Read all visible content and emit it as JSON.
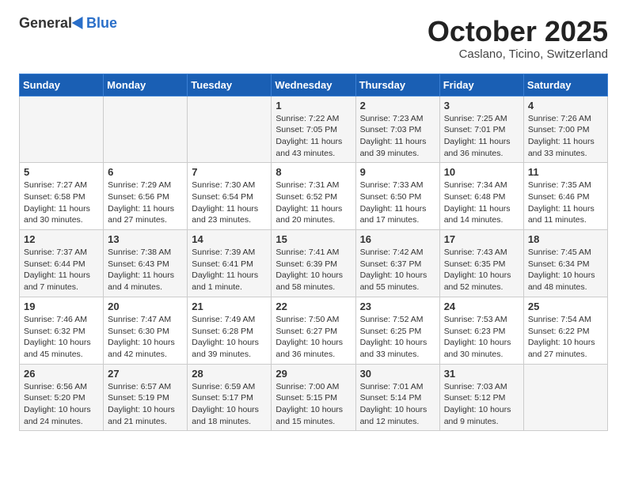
{
  "header": {
    "logo_general": "General",
    "logo_blue": "Blue",
    "month": "October 2025",
    "location": "Caslano, Ticino, Switzerland"
  },
  "days_of_week": [
    "Sunday",
    "Monday",
    "Tuesday",
    "Wednesday",
    "Thursday",
    "Friday",
    "Saturday"
  ],
  "weeks": [
    [
      {
        "day": "",
        "content": ""
      },
      {
        "day": "",
        "content": ""
      },
      {
        "day": "",
        "content": ""
      },
      {
        "day": "1",
        "content": "Sunrise: 7:22 AM\nSunset: 7:05 PM\nDaylight: 11 hours and 43 minutes."
      },
      {
        "day": "2",
        "content": "Sunrise: 7:23 AM\nSunset: 7:03 PM\nDaylight: 11 hours and 39 minutes."
      },
      {
        "day": "3",
        "content": "Sunrise: 7:25 AM\nSunset: 7:01 PM\nDaylight: 11 hours and 36 minutes."
      },
      {
        "day": "4",
        "content": "Sunrise: 7:26 AM\nSunset: 7:00 PM\nDaylight: 11 hours and 33 minutes."
      }
    ],
    [
      {
        "day": "5",
        "content": "Sunrise: 7:27 AM\nSunset: 6:58 PM\nDaylight: 11 hours and 30 minutes."
      },
      {
        "day": "6",
        "content": "Sunrise: 7:29 AM\nSunset: 6:56 PM\nDaylight: 11 hours and 27 minutes."
      },
      {
        "day": "7",
        "content": "Sunrise: 7:30 AM\nSunset: 6:54 PM\nDaylight: 11 hours and 23 minutes."
      },
      {
        "day": "8",
        "content": "Sunrise: 7:31 AM\nSunset: 6:52 PM\nDaylight: 11 hours and 20 minutes."
      },
      {
        "day": "9",
        "content": "Sunrise: 7:33 AM\nSunset: 6:50 PM\nDaylight: 11 hours and 17 minutes."
      },
      {
        "day": "10",
        "content": "Sunrise: 7:34 AM\nSunset: 6:48 PM\nDaylight: 11 hours and 14 minutes."
      },
      {
        "day": "11",
        "content": "Sunrise: 7:35 AM\nSunset: 6:46 PM\nDaylight: 11 hours and 11 minutes."
      }
    ],
    [
      {
        "day": "12",
        "content": "Sunrise: 7:37 AM\nSunset: 6:44 PM\nDaylight: 11 hours and 7 minutes."
      },
      {
        "day": "13",
        "content": "Sunrise: 7:38 AM\nSunset: 6:43 PM\nDaylight: 11 hours and 4 minutes."
      },
      {
        "day": "14",
        "content": "Sunrise: 7:39 AM\nSunset: 6:41 PM\nDaylight: 11 hours and 1 minute."
      },
      {
        "day": "15",
        "content": "Sunrise: 7:41 AM\nSunset: 6:39 PM\nDaylight: 10 hours and 58 minutes."
      },
      {
        "day": "16",
        "content": "Sunrise: 7:42 AM\nSunset: 6:37 PM\nDaylight: 10 hours and 55 minutes."
      },
      {
        "day": "17",
        "content": "Sunrise: 7:43 AM\nSunset: 6:35 PM\nDaylight: 10 hours and 52 minutes."
      },
      {
        "day": "18",
        "content": "Sunrise: 7:45 AM\nSunset: 6:34 PM\nDaylight: 10 hours and 48 minutes."
      }
    ],
    [
      {
        "day": "19",
        "content": "Sunrise: 7:46 AM\nSunset: 6:32 PM\nDaylight: 10 hours and 45 minutes."
      },
      {
        "day": "20",
        "content": "Sunrise: 7:47 AM\nSunset: 6:30 PM\nDaylight: 10 hours and 42 minutes."
      },
      {
        "day": "21",
        "content": "Sunrise: 7:49 AM\nSunset: 6:28 PM\nDaylight: 10 hours and 39 minutes."
      },
      {
        "day": "22",
        "content": "Sunrise: 7:50 AM\nSunset: 6:27 PM\nDaylight: 10 hours and 36 minutes."
      },
      {
        "day": "23",
        "content": "Sunrise: 7:52 AM\nSunset: 6:25 PM\nDaylight: 10 hours and 33 minutes."
      },
      {
        "day": "24",
        "content": "Sunrise: 7:53 AM\nSunset: 6:23 PM\nDaylight: 10 hours and 30 minutes."
      },
      {
        "day": "25",
        "content": "Sunrise: 7:54 AM\nSunset: 6:22 PM\nDaylight: 10 hours and 27 minutes."
      }
    ],
    [
      {
        "day": "26",
        "content": "Sunrise: 6:56 AM\nSunset: 5:20 PM\nDaylight: 10 hours and 24 minutes."
      },
      {
        "day": "27",
        "content": "Sunrise: 6:57 AM\nSunset: 5:19 PM\nDaylight: 10 hours and 21 minutes."
      },
      {
        "day": "28",
        "content": "Sunrise: 6:59 AM\nSunset: 5:17 PM\nDaylight: 10 hours and 18 minutes."
      },
      {
        "day": "29",
        "content": "Sunrise: 7:00 AM\nSunset: 5:15 PM\nDaylight: 10 hours and 15 minutes."
      },
      {
        "day": "30",
        "content": "Sunrise: 7:01 AM\nSunset: 5:14 PM\nDaylight: 10 hours and 12 minutes."
      },
      {
        "day": "31",
        "content": "Sunrise: 7:03 AM\nSunset: 5:12 PM\nDaylight: 10 hours and 9 minutes."
      },
      {
        "day": "",
        "content": ""
      }
    ]
  ]
}
